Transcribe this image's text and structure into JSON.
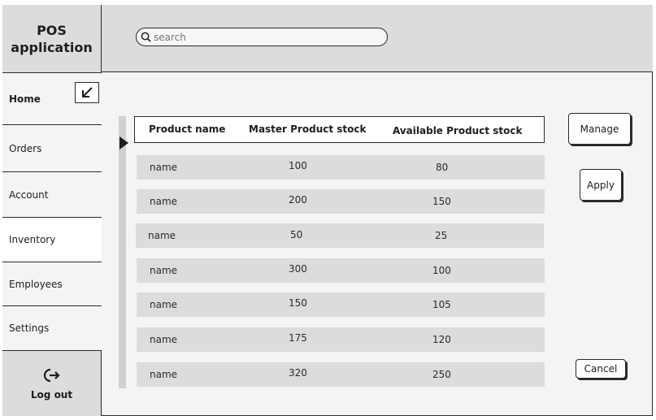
{
  "app": {
    "title": "POS\napplication"
  },
  "search": {
    "placeholder": "search",
    "value": ""
  },
  "sidebar": {
    "items": [
      {
        "label": "Home"
      },
      {
        "label": "Orders"
      },
      {
        "label": "Account"
      },
      {
        "label": "Inventory"
      },
      {
        "label": "Employees"
      },
      {
        "label": "Settings"
      }
    ],
    "active": "Inventory",
    "logout_label": "Log out"
  },
  "table": {
    "headers": [
      "Product name",
      "Master Product stock",
      "Available Product stock"
    ],
    "rows": [
      [
        "name",
        "100",
        "80"
      ],
      [
        "name",
        "200",
        "150"
      ],
      [
        "name",
        "50",
        "25"
      ],
      [
        "name",
        "300",
        "100"
      ],
      [
        "name",
        "150",
        "105"
      ],
      [
        "name",
        "175",
        "120"
      ],
      [
        "name",
        "320",
        "250"
      ]
    ]
  },
  "actions": {
    "manage_label": "Manage",
    "apply_label": "Apply",
    "cancel_label": "Cancel"
  },
  "colors": {
    "panel": "#dcdcdc",
    "background": "#f4f4f4",
    "border": "#2a2a2a"
  }
}
